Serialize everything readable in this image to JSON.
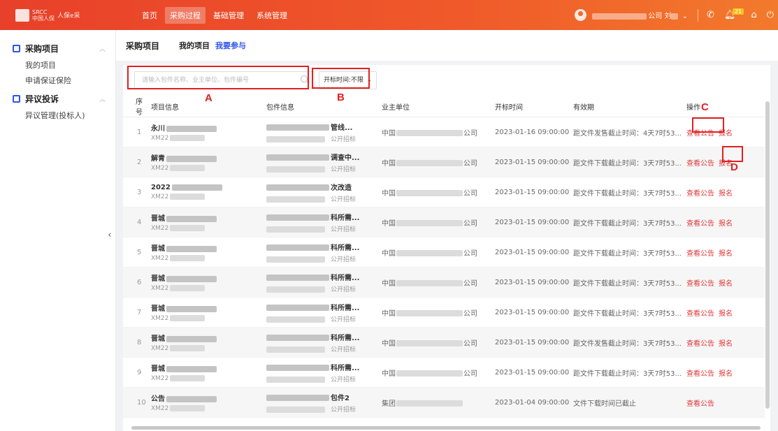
{
  "topbar": {
    "brand_line1": "SRCC",
    "brand_line2": "中国人保",
    "brand_name": "人保e采",
    "nav": [
      "首页",
      "采购过程",
      "基础管理",
      "系统管理"
    ],
    "nav_active": 1,
    "user_org_suffix": "公司",
    "user_name": "刘",
    "notification_count": "21"
  },
  "sidebar": {
    "groups": [
      {
        "title": "采购项目",
        "items": [
          "我的项目",
          "申请保证保险"
        ]
      },
      {
        "title": "异议投诉",
        "items": [
          "异议管理(投标人)"
        ]
      }
    ]
  },
  "main": {
    "title": "采购项目",
    "tabs": [
      "我的项目",
      "我要参与"
    ],
    "active_tab": 1,
    "search_placeholder": "请输入包件名称、业主单位、包件编号",
    "time_filter": "开标时间:不限",
    "columns": [
      "序号",
      "项目信息",
      "包件信息",
      "业主单位",
      "开标时间",
      "有效期",
      "操作"
    ],
    "rows": [
      {
        "no": "1",
        "proj": "永川",
        "proj_code": "XM22",
        "pkg": "管线...",
        "pkg_method": "公开招标",
        "owner": "中国",
        "owner_suffix": "公司",
        "open_time": "2023-01-16 09:00:00",
        "valid": "距文件发售截止时间：4天7时53...",
        "ops": [
          "查看公告",
          "报名"
        ]
      },
      {
        "no": "2",
        "proj": "解青",
        "proj_code": "XM22",
        "pkg": "调查中...",
        "pkg_method": "公开招标",
        "owner": "中国",
        "owner_suffix": "公司",
        "open_time": "2023-01-15 09:00:00",
        "valid": "距文件下载截止时间：3天7时53...",
        "ops": [
          "查看公告",
          "报名"
        ]
      },
      {
        "no": "3",
        "proj": "2022",
        "proj_code": "XM22",
        "pkg": "次改造",
        "pkg_method": "公开招标",
        "owner": "中国",
        "owner_suffix": "公司",
        "open_time": "2023-01-15 09:00:00",
        "valid": "距文件下载截止时间：3天7时53...",
        "ops": [
          "查看公告",
          "报名"
        ]
      },
      {
        "no": "4",
        "proj": "晋城",
        "proj_code": "XM22",
        "pkg": "科所需...",
        "pkg_method": "公开招标",
        "owner": "中国",
        "owner_suffix": "公司",
        "open_time": "2023-01-15 09:00:00",
        "valid": "距文件下载截止时间：3天7时53...",
        "ops": [
          "查看公告",
          "报名"
        ]
      },
      {
        "no": "5",
        "proj": "晋城",
        "proj_code": "XM22",
        "pkg": "科所需...",
        "pkg_method": "公开招标",
        "owner": "中国",
        "owner_suffix": "公司",
        "open_time": "2023-01-15 09:00:00",
        "valid": "距文件下载截止时间：3天7时53...",
        "ops": [
          "查看公告",
          "报名"
        ]
      },
      {
        "no": "6",
        "proj": "晋城",
        "proj_code": "XM22",
        "pkg": "科所需...",
        "pkg_method": "公开招标",
        "owner": "中国",
        "owner_suffix": "公司",
        "open_time": "2023-01-15 09:00:00",
        "valid": "距文件下载截止时间：3天7时53...",
        "ops": [
          "查看公告",
          "报名"
        ]
      },
      {
        "no": "7",
        "proj": "晋城",
        "proj_code": "XM22",
        "pkg": "科所需...",
        "pkg_method": "公开招标",
        "owner": "中国",
        "owner_suffix": "公司",
        "open_time": "2023-01-15 09:00:00",
        "valid": "距文件下载截止时间：3天7时53...",
        "ops": [
          "查看公告",
          "报名"
        ]
      },
      {
        "no": "8",
        "proj": "晋城",
        "proj_code": "XM22",
        "pkg": "科所需...",
        "pkg_method": "公开招标",
        "owner": "中国",
        "owner_suffix": "公司",
        "open_time": "2023-01-15 09:00:00",
        "valid": "距文件发售截止时间：3天7时53...",
        "ops": [
          "查看公告",
          "报名"
        ]
      },
      {
        "no": "9",
        "proj": "晋城",
        "proj_code": "XM22",
        "pkg": "科所需...",
        "pkg_method": "公开招标",
        "owner": "中国",
        "owner_suffix": "公司",
        "open_time": "2023-01-15 09:00:00",
        "valid": "距文件下载截止时间：3天7时53...",
        "ops": [
          "查看公告",
          "报名"
        ]
      },
      {
        "no": "10",
        "proj": "公告",
        "proj_code": "XM22",
        "pkg": "包件2",
        "pkg_method": "公开招标",
        "owner": "集团",
        "owner_suffix": "",
        "open_time": "2023-01-04 09:00:00",
        "valid": "文件下载时间已截止",
        "ops": [
          "查看公告"
        ]
      }
    ]
  },
  "annotations": [
    "A",
    "B",
    "C",
    "D"
  ],
  "colors": {
    "topbar": "#ea4a2a",
    "accent_blue": "#2f54eb",
    "action_red": "#e0393a",
    "annotation_red": "#e02020"
  }
}
